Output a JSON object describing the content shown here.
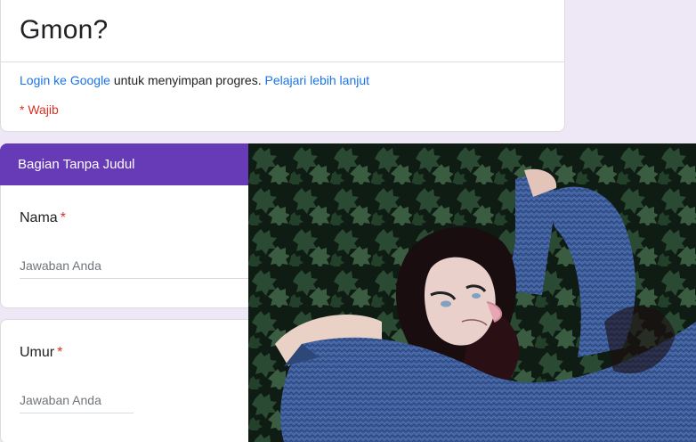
{
  "form": {
    "title": "Gmon?",
    "login_link": "Login ke Google",
    "login_text": " untuk menyimpan progres. ",
    "learn_more_link": "Pelajari lebih lanjut",
    "required_note": "* Wajib"
  },
  "section": {
    "title": "Bagian Tanpa Judul"
  },
  "questions": [
    {
      "label": "Nama",
      "required_mark": "*",
      "placeholder": "Jawaban Anda"
    },
    {
      "label": "Umur",
      "required_mark": "*",
      "placeholder": "Jawaban Anda"
    }
  ],
  "colors": {
    "page_bg": "#ede7f6",
    "section_header": "#673ab7",
    "required": "#d93025",
    "link": "#1a73e8"
  },
  "artwork": {
    "subject": "illustration of woman lying on leaves in blue sweater"
  }
}
